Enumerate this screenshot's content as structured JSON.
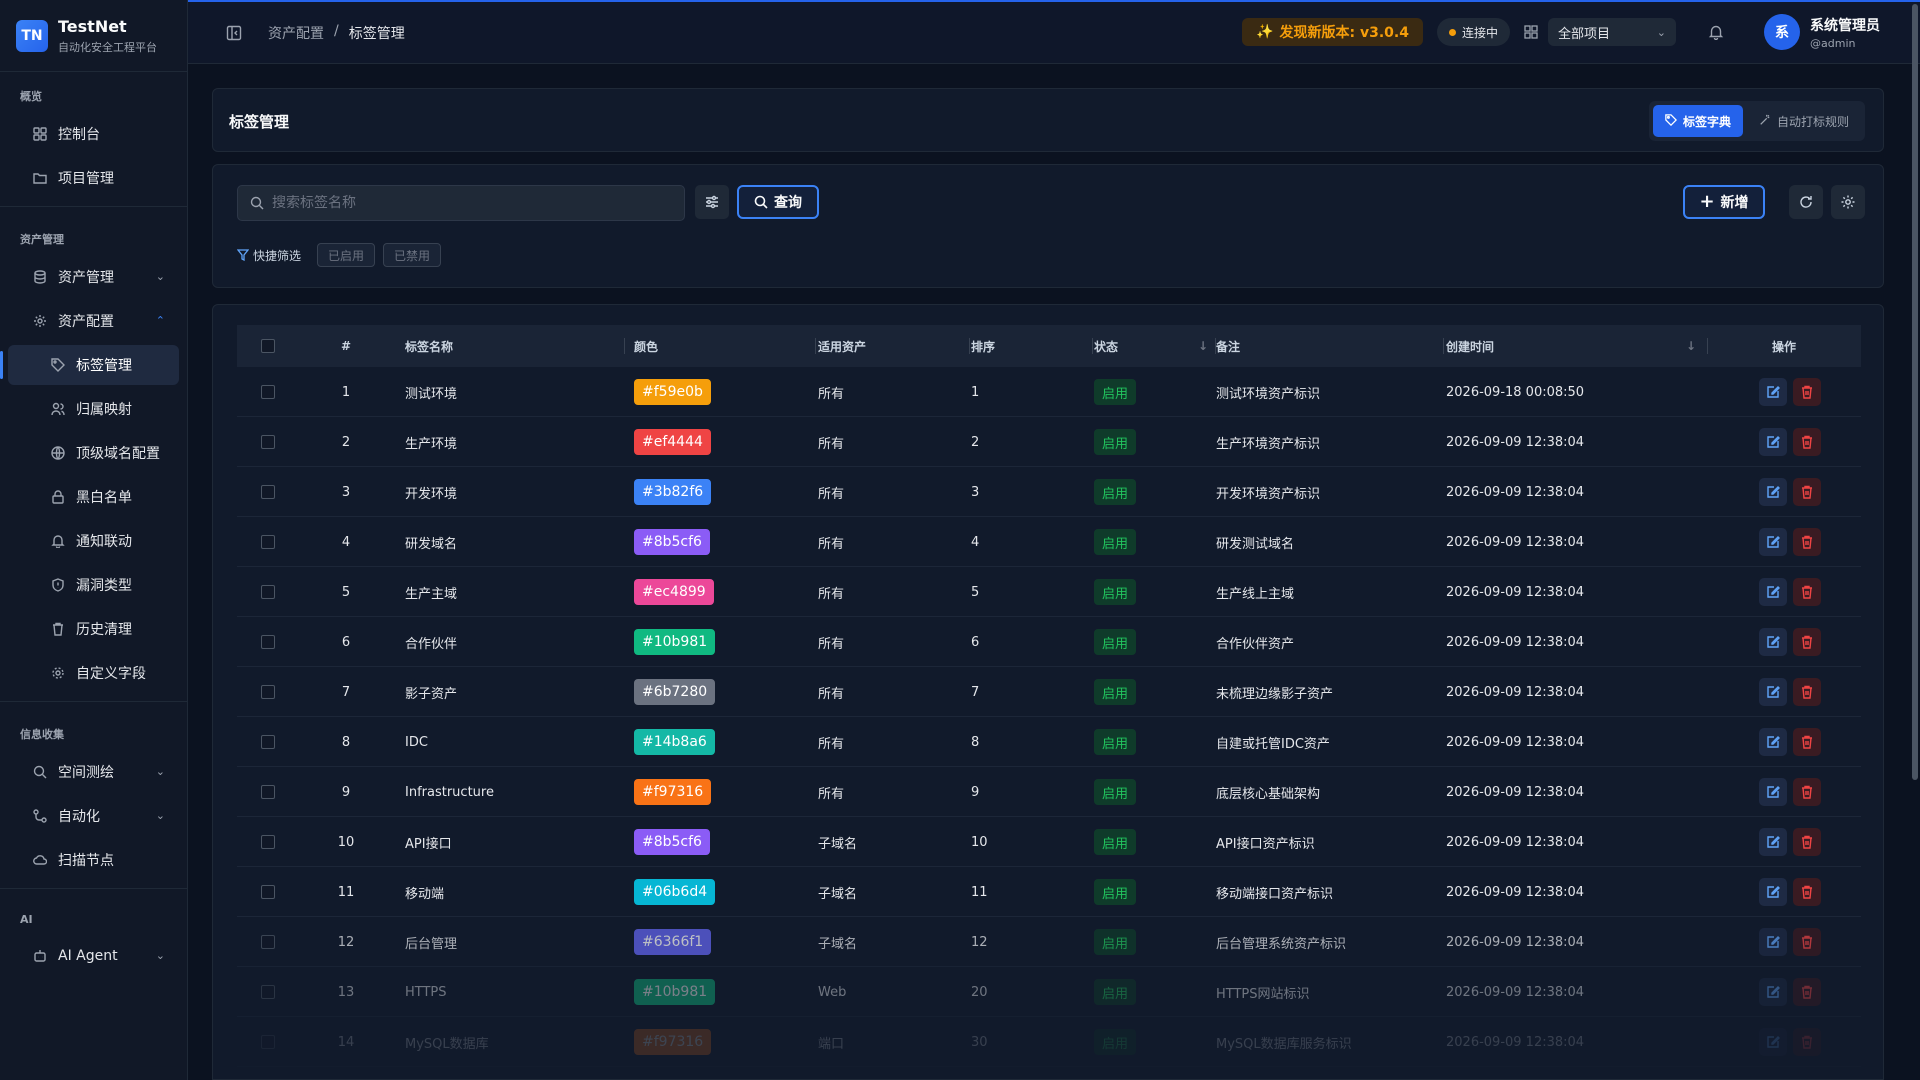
{
  "app": {
    "logo_text": "TN",
    "name": "TestNet",
    "subtitle": "自动化安全工程平台"
  },
  "sidebar": {
    "sections": {
      "overview": "概览",
      "assets": "资产管理",
      "info": "信息收集",
      "ai": "AI"
    },
    "items": {
      "dashboard": "控制台",
      "projects": "项目管理",
      "asset_mgmt": "资产管理",
      "asset_config": "资产配置",
      "tag_mgmt": "标签管理",
      "ownership": "归属映射",
      "tld_config": "顶级域名配置",
      "blackwhite": "黑白名单",
      "notify": "通知联动",
      "vuln_types": "漏洞类型",
      "history_clean": "历史清理",
      "custom_fields": "自定义字段",
      "space_mapping": "空间测绘",
      "automation": "自动化",
      "scan_nodes": "扫描节点",
      "ai_agent": "AI Agent"
    }
  },
  "header": {
    "breadcrumb": [
      "资产配置",
      "/",
      "标签管理"
    ],
    "version_text": "发现新版本: v3.0.4",
    "connection_text": "连接中",
    "project_select": "全部项目",
    "user_avatar": "系",
    "user_name": "系统管理员",
    "user_handle": "@admin"
  },
  "page": {
    "title": "标签管理",
    "tabs": {
      "dictionary": "标签字典",
      "auto_rules": "自动打标规则"
    },
    "search_placeholder": "搜索标签名称",
    "query_label": "查询",
    "quick_filter_label": "快捷筛选",
    "chip_enabled": "已启用",
    "chip_disabled": "已禁用",
    "add_label": "新增"
  },
  "table": {
    "columns": {
      "index": "#",
      "name": "标签名称",
      "color": "颜色",
      "scope": "适用资产",
      "order": "排序",
      "status": "状态",
      "remark": "备注",
      "created": "创建时间",
      "actions": "操作"
    },
    "rows": [
      {
        "idx": "1",
        "name": "测试环境",
        "color": "#f59e0b",
        "scope": "所有",
        "order": "1",
        "status": "启用",
        "remark": "测试环境资产标识",
        "created": "2026-09-18 00:08:50"
      },
      {
        "idx": "2",
        "name": "生产环境",
        "color": "#ef4444",
        "scope": "所有",
        "order": "2",
        "status": "启用",
        "remark": "生产环境资产标识",
        "created": "2026-09-09 12:38:04"
      },
      {
        "idx": "3",
        "name": "开发环境",
        "color": "#3b82f6",
        "scope": "所有",
        "order": "3",
        "status": "启用",
        "remark": "开发环境资产标识",
        "created": "2026-09-09 12:38:04"
      },
      {
        "idx": "4",
        "name": "研发域名",
        "color": "#8b5cf6",
        "scope": "所有",
        "order": "4",
        "status": "启用",
        "remark": "研发测试域名",
        "created": "2026-09-09 12:38:04"
      },
      {
        "idx": "5",
        "name": "生产主域",
        "color": "#ec4899",
        "scope": "所有",
        "order": "5",
        "status": "启用",
        "remark": "生产线上主域",
        "created": "2026-09-09 12:38:04"
      },
      {
        "idx": "6",
        "name": "合作伙伴",
        "color": "#10b981",
        "scope": "所有",
        "order": "6",
        "status": "启用",
        "remark": "合作伙伴资产",
        "created": "2026-09-09 12:38:04"
      },
      {
        "idx": "7",
        "name": "影子资产",
        "color": "#6b7280",
        "scope": "所有",
        "order": "7",
        "status": "启用",
        "remark": "未梳理边缘影子资产",
        "created": "2026-09-09 12:38:04"
      },
      {
        "idx": "8",
        "name": "IDC",
        "color": "#14b8a6",
        "scope": "所有",
        "order": "8",
        "status": "启用",
        "remark": "自建或托管IDC资产",
        "created": "2026-09-09 12:38:04"
      },
      {
        "idx": "9",
        "name": "Infrastructure",
        "color": "#f97316",
        "scope": "所有",
        "order": "9",
        "status": "启用",
        "remark": "底层核心基础架构",
        "created": "2026-09-09 12:38:04"
      },
      {
        "idx": "10",
        "name": "API接口",
        "color": "#8b5cf6",
        "scope": "子域名",
        "order": "10",
        "status": "启用",
        "remark": "API接口资产标识",
        "created": "2026-09-09 12:38:04"
      },
      {
        "idx": "11",
        "name": "移动端",
        "color": "#06b6d4",
        "scope": "子域名",
        "order": "11",
        "status": "启用",
        "remark": "移动端接口资产标识",
        "created": "2026-09-09 12:38:04"
      },
      {
        "idx": "12",
        "name": "后台管理",
        "color": "#6366f1",
        "scope": "子域名",
        "order": "12",
        "status": "启用",
        "remark": "后台管理系统资产标识",
        "created": "2026-09-09 12:38:04"
      },
      {
        "idx": "13",
        "name": "HTTPS",
        "color": "#10b981",
        "scope": "Web",
        "order": "20",
        "status": "启用",
        "remark": "HTTPS网站标识",
        "created": "2026-09-09 12:38:04"
      },
      {
        "idx": "14",
        "name": "MySQL数据库",
        "color": "#f97316",
        "scope": "端口",
        "order": "30",
        "status": "启用",
        "remark": "MySQL数据库服务标识",
        "created": "2026-09-09 12:38:04"
      }
    ]
  },
  "colors": {
    "accent": "#3b82f6",
    "brand_gradient_start": "#3b82f6",
    "version_text": "#f59e0b",
    "status_enabled": "#22c55e",
    "danger": "#ef4444"
  }
}
